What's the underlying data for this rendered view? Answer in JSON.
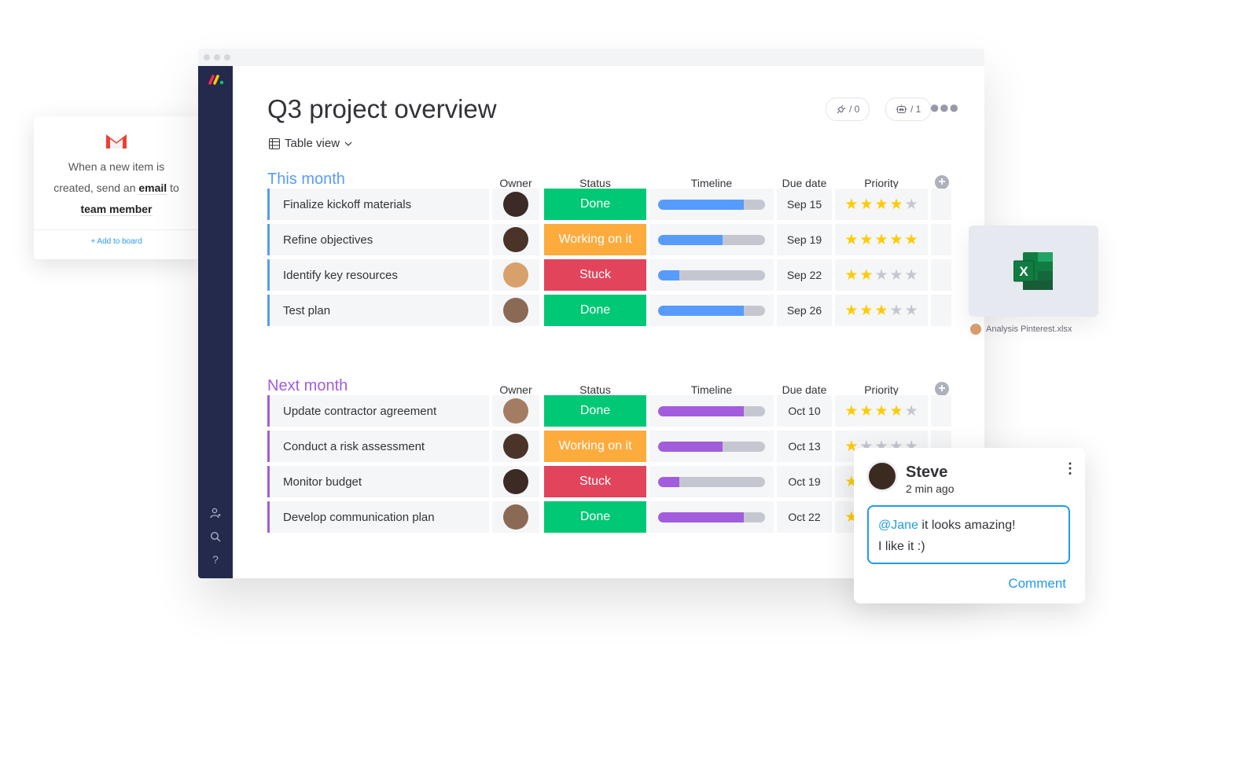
{
  "gmail_card": {
    "line1": "When a new item is",
    "line2_pre": "created, send an ",
    "line2_bold": "email",
    "line2_post": " to",
    "line3_bold": "team member",
    "add_label": "+ Add to board"
  },
  "board": {
    "title": "Q3 project overview",
    "view_label": "Table view",
    "integrations_count": "/ 0",
    "automations_count": "/ 1",
    "columns": {
      "owner": "Owner",
      "status": "Status",
      "timeline": "Timeline",
      "due": "Due date",
      "priority": "Priority"
    },
    "groups": [
      {
        "title": "This month",
        "color": "#579bfc",
        "rows": [
          {
            "name": "Finalize kickoff materials",
            "owner": "A",
            "status": "Done",
            "timeline": 0.8,
            "due": "Sep 15",
            "priority": 4
          },
          {
            "name": "Refine objectives",
            "owner": "B",
            "status": "Working on it",
            "timeline": 0.6,
            "due": "Sep 19",
            "priority": 5
          },
          {
            "name": "Identify key resources",
            "owner": "C",
            "status": "Stuck",
            "timeline": 0.2,
            "due": "Sep 22",
            "priority": 2
          },
          {
            "name": "Test plan",
            "owner": "D",
            "status": "Done",
            "timeline": 0.8,
            "due": "Sep 26",
            "priority": 3
          }
        ]
      },
      {
        "title": "Next month",
        "color": "#a25ddc",
        "rows": [
          {
            "name": "Update contractor agreement",
            "owner": "E",
            "status": "Done",
            "timeline": 0.8,
            "due": "Oct 10",
            "priority": 4
          },
          {
            "name": "Conduct a risk assessment",
            "owner": "B",
            "status": "Working on it",
            "timeline": 0.6,
            "due": "Oct 13",
            "priority": 1
          },
          {
            "name": "Monitor budget",
            "owner": "F",
            "status": "Stuck",
            "timeline": 0.2,
            "due": "Oct 19",
            "priority": 1
          },
          {
            "name": "Develop communication plan",
            "owner": "D",
            "status": "Done",
            "timeline": 0.8,
            "due": "Oct 22",
            "priority": 1
          }
        ]
      }
    ],
    "status_colors": {
      "Done": "#00c875",
      "Working on it": "#fdab3d",
      "Stuck": "#e2445c"
    }
  },
  "file": {
    "name": "Analysis Pinterest.xlsx"
  },
  "comment": {
    "author": "Steve",
    "time": "2 min ago",
    "mention": "@Jane",
    "text_rest": " it looks amazing!",
    "line2": "I like it :)",
    "button": "Comment"
  },
  "sidebar_icons": [
    "invite-user-icon",
    "search-icon",
    "help-icon"
  ]
}
